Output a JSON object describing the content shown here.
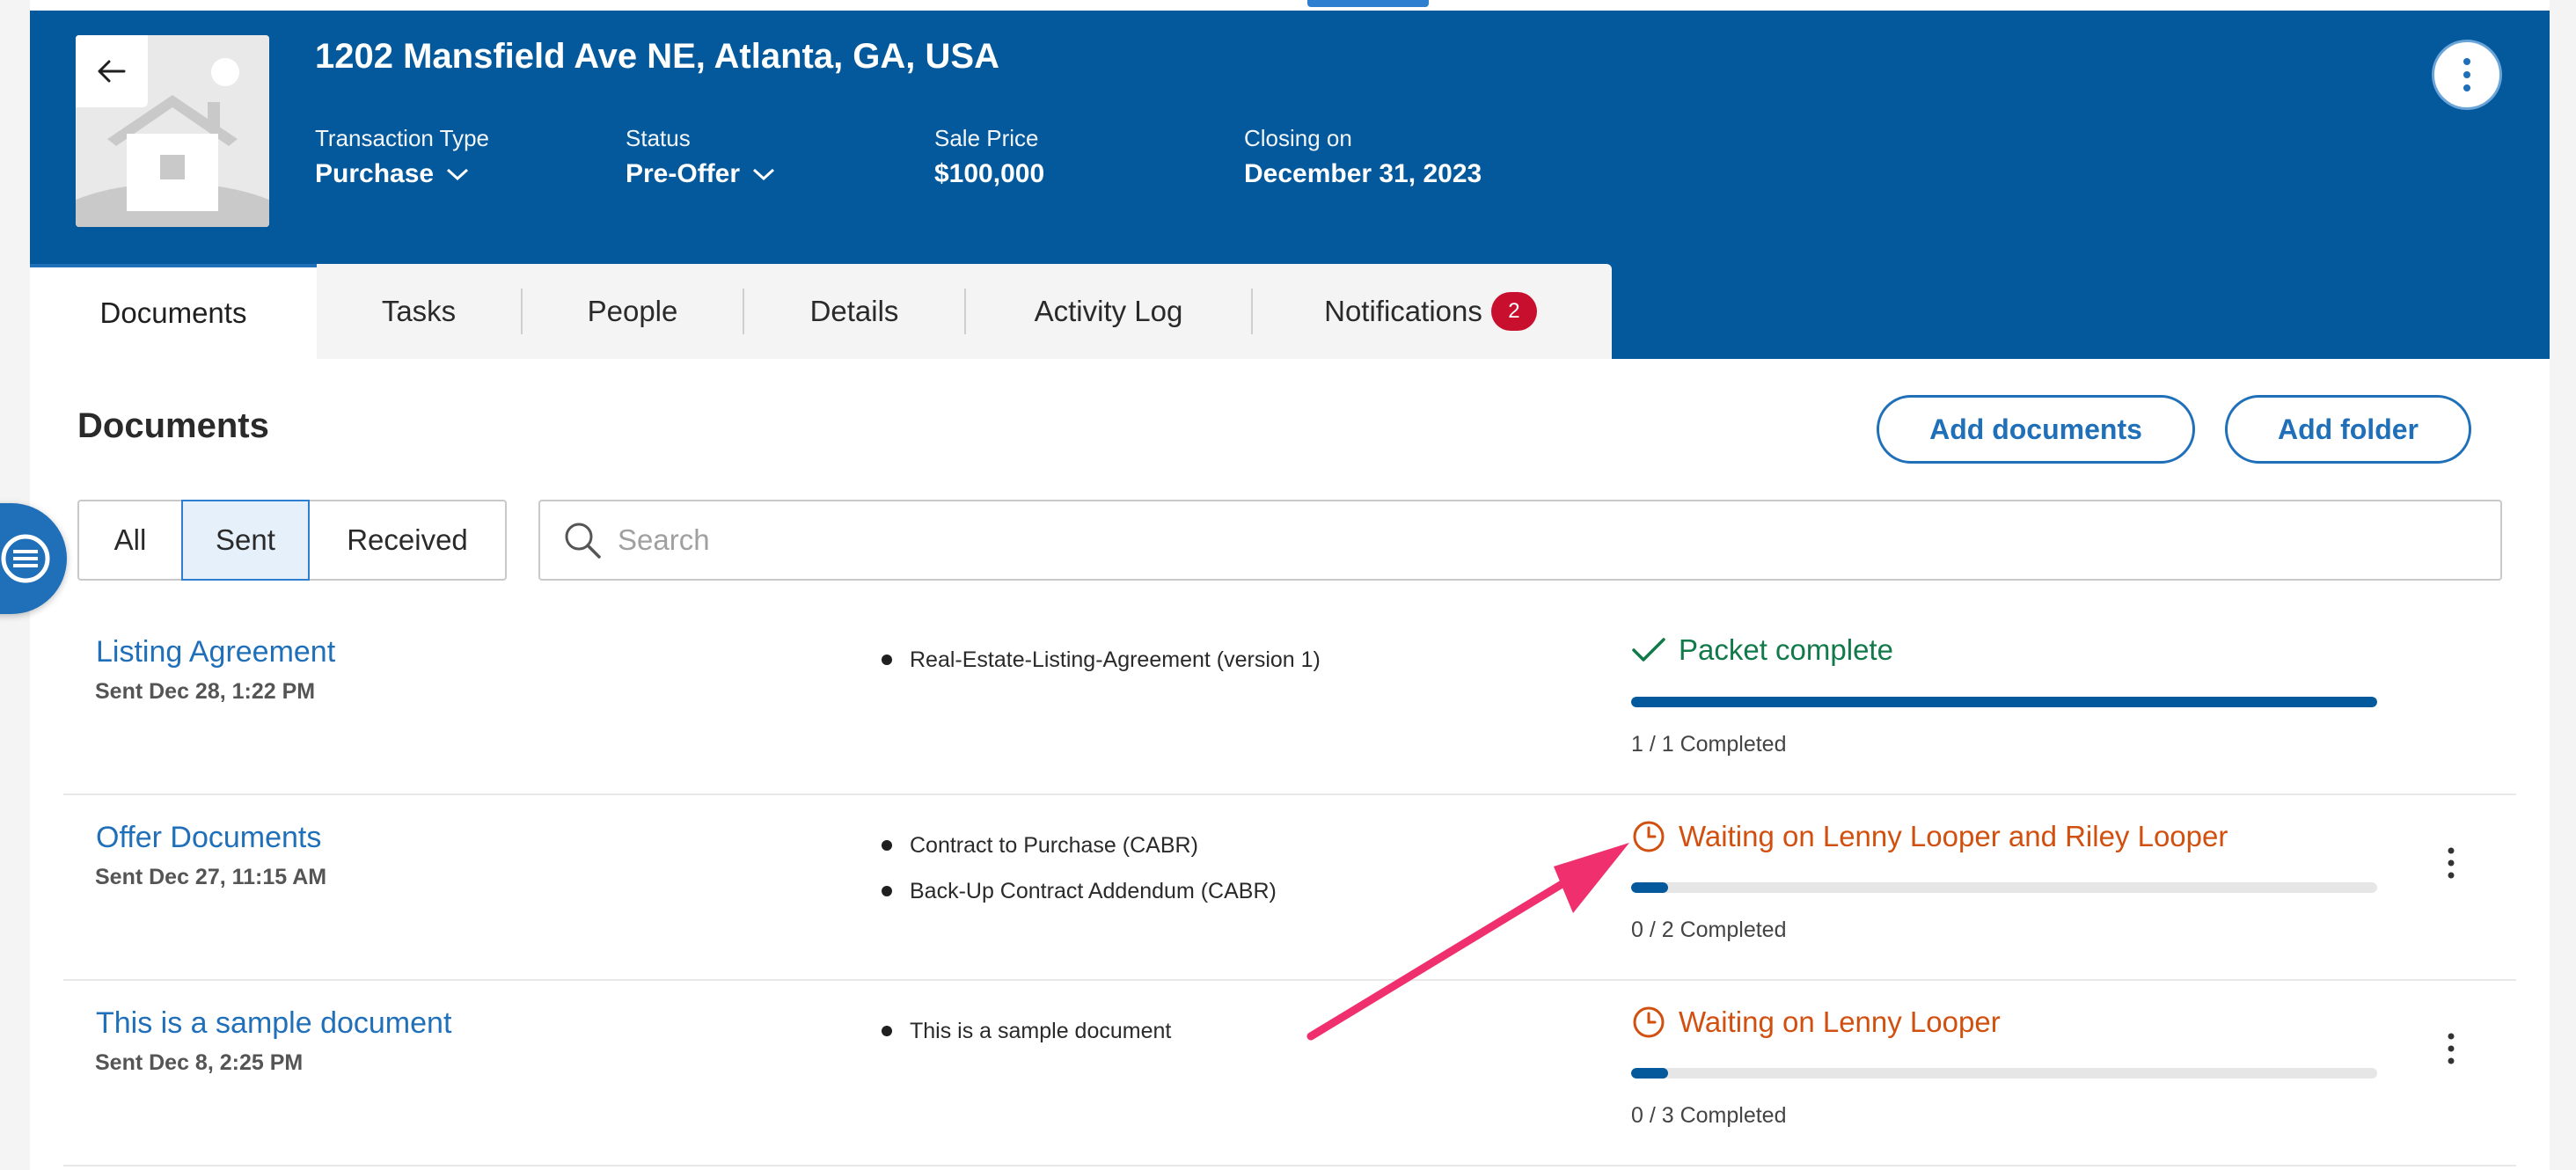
{
  "header": {
    "address": "1202 Mansfield Ave NE, Atlanta, GA, USA",
    "fields": [
      {
        "label": "Transaction Type",
        "value": "Purchase",
        "dropdown": true
      },
      {
        "label": "Status",
        "value": "Pre-Offer",
        "dropdown": true
      },
      {
        "label": "Sale Price",
        "value": "$100,000",
        "dropdown": false
      },
      {
        "label": "Closing on",
        "value": "December 31, 2023",
        "dropdown": false
      }
    ],
    "icons": {
      "back": "arrow-left-icon",
      "more": "vertical-dots-icon",
      "thumbnail": "house-placeholder-icon"
    }
  },
  "tabs": [
    {
      "label": "Documents",
      "active": true
    },
    {
      "label": "Tasks"
    },
    {
      "label": "People"
    },
    {
      "label": "Details"
    },
    {
      "label": "Activity Log"
    },
    {
      "label": "Notifications",
      "badge": "2"
    }
  ],
  "documents": {
    "title": "Documents",
    "add_documents_label": "Add documents",
    "add_folder_label": "Add folder",
    "filters": {
      "all": "All",
      "sent": "Sent",
      "received": "Received",
      "selected": "Sent"
    },
    "search_placeholder": "Search",
    "rows": [
      {
        "name": "Listing Agreement",
        "sent": "Sent Dec 28, 1:22 PM",
        "files": [
          "Real-Estate-Listing-Agreement (version 1)"
        ],
        "status": "Packet complete",
        "status_type": "complete",
        "progress": 1.0,
        "progress_text": "1 / 1 Completed"
      },
      {
        "name": "Offer Documents",
        "sent": "Sent Dec 27, 11:15 AM",
        "files": [
          "Contract to Purchase (CABR)",
          "Back-Up Contract Addendum (CABR)"
        ],
        "status": "Waiting on Lenny Looper and Riley Looper",
        "status_type": "waiting",
        "progress": 0.05,
        "progress_text": "0 / 2 Completed"
      },
      {
        "name": "This is a sample document",
        "sent": "Sent Dec 8, 2:25 PM",
        "files": [
          "This is a sample document"
        ],
        "status": "Waiting on Lenny Looper",
        "status_type": "waiting",
        "progress": 0.05,
        "progress_text": "0 / 3 Completed"
      }
    ]
  },
  "colors": {
    "header_bg": "#03599b",
    "link_blue": "#1f6fb9",
    "complete_green": "#11794a",
    "waiting_orange": "#d2500f",
    "badge_red": "#c8102e",
    "annotation_arrow": "#f0306e"
  }
}
